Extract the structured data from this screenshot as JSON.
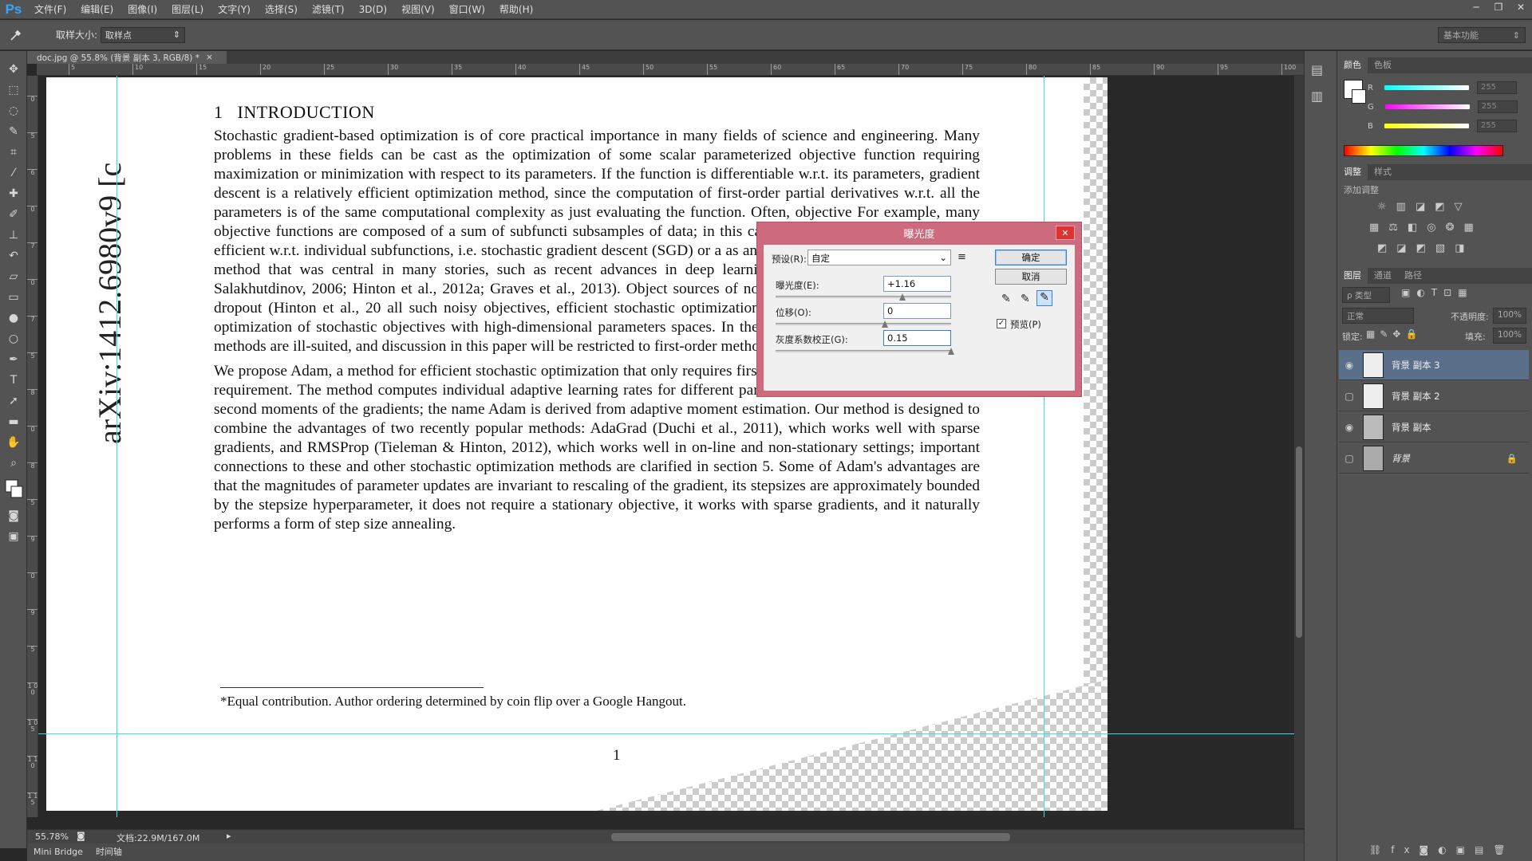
{
  "app": {
    "logo": "Ps",
    "menu": [
      "文件(F)",
      "编辑(E)",
      "图像(I)",
      "图层(L)",
      "文字(Y)",
      "选择(S)",
      "滤镜(T)",
      "3D(D)",
      "视图(V)",
      "窗口(W)",
      "帮助(H)"
    ],
    "window_controls": [
      "─",
      "❐",
      "✕"
    ]
  },
  "options_bar": {
    "sample_size_label": "取样大小:",
    "sample_size_value": "取样点",
    "workspace": "基本功能"
  },
  "document": {
    "tab_title": "doc.jpg @ 55.8% (背景 副本 3, RGB/8) *",
    "tab_close": "×",
    "ruler_top": [
      "5",
      "10",
      "15",
      "20",
      "25",
      "30",
      "35",
      "40",
      "45",
      "50",
      "55",
      "60",
      "65",
      "70",
      "75",
      "80",
      "85",
      "90",
      "95",
      "100"
    ],
    "ruler_left": [
      "0",
      "5",
      "6",
      "0",
      "7",
      "0",
      "7",
      "5",
      "8",
      "0",
      "8",
      "5",
      "9",
      "0",
      "9",
      "5",
      "1 0 0",
      "1 0 5",
      "1 1 0",
      "1 1 5"
    ]
  },
  "paper": {
    "arxiv_id": "arXiv:1412.6980v9  [c",
    "section_number": "1",
    "section_title": "INTRODUCTION",
    "paragraph1": "Stochastic gradient-based optimization is of core practical importance in many fields of science and engineering. Many problems in these fields can be cast as the optimization of some scalar parameterized objective function requiring maximization or minimization with respect to its parameters. If the function is differentiable w.r.t. its parameters, gradient descent is a relatively efficient optimization method, since the computation of first-order partial derivatives w.r.t. all the parameters is of the same computational complexity as just evaluating the function. Often, objective For example, many objective functions are composed of a sum of subfuncti subsamples of data; in this case optimization can be made more efficient w.r.t. individual subfunctions, i.e. stochastic gradient descent (SGD) or a as an efficient and effective optimization method that was central in many stories, such as recent advances in deep learning (Deng et al., 2013; Krizhe & Salakhutdinov, 2006; Hinton et al., 2012a; Graves et al., 2013). Object sources of noise than data subsampling, such as dropout (Hinton et al., 20 all such noisy objectives, efficient stochastic optimization techniques are re paper is on the optimization of stochastic objectives with high-dimensional parameters spaces. In these cases, higher-order optimization methods are ill-suited, and discussion in this paper will be restricted to first-order methods.",
    "paragraph2": "We propose Adam, a method for efficient stochastic optimization that only requires first-order gradients with little memory requirement. The method computes individual adaptive learning rates for different parameters from estimates of first and second moments of the gradients; the name Adam is derived from adaptive moment estimation. Our method is designed to combine the advantages of two recently popular methods: AdaGrad (Duchi et al., 2011), which works well with sparse gradients, and RMSProp (Tieleman & Hinton, 2012), which works well in on-line and non-stationary settings; important connections to these and other stochastic optimization methods are clarified in section 5. Some of Adam's advantages are that the magnitudes of parameter updates are invariant to rescaling of the gradient, its stepsizes are approximately bounded by the stepsize hyperparameter, it does not require a stationary objective, it works with sparse gradients, and it naturally performs a form of step size annealing.",
    "footnote": "*Equal contribution. Author ordering determined by coin flip over a Google Hangout.",
    "page_number": "1"
  },
  "status": {
    "zoom": "55.78%",
    "doc_size": "文档:22.9M/167.0M"
  },
  "bottom_tabs": [
    "Mini Bridge",
    "时间轴"
  ],
  "dialog": {
    "title": "曝光度",
    "close": "✕",
    "preset_label": "预设(R):",
    "preset_value": "自定",
    "exposure_label": "曝光度(E):",
    "exposure_value": "+1.16",
    "offset_label": "位移(O):",
    "offset_value": "0",
    "gamma_label": "灰度系数校正(G):",
    "gamma_value": "0.15",
    "ok": "确定",
    "cancel": "取消",
    "preview_label": "预览(P)",
    "preview_checked": true
  },
  "color_panel": {
    "tabs": [
      "颜色",
      "色板"
    ],
    "channels": [
      {
        "name": "R",
        "value": "255",
        "color": "#00e5e5"
      },
      {
        "name": "G",
        "value": "255",
        "color": "#e500e5"
      },
      {
        "name": "B",
        "value": "255",
        "color": "#e5e500"
      }
    ]
  },
  "adjust_panel": {
    "tabs": [
      "调整",
      "样式"
    ],
    "add_label": "添加调整"
  },
  "layers_panel": {
    "tabs": [
      "图层",
      "通道",
      "路径"
    ],
    "filter": "ρ 类型",
    "blend_mode": "正常",
    "opacity_label": "不透明度:",
    "opacity_value": "100%",
    "lock_label": "锁定:",
    "fill_label": "填充:",
    "fill_value": "100%",
    "layers": [
      {
        "name": "背景 副本 3",
        "visible": true,
        "selected": true
      },
      {
        "name": "背景 副本 2",
        "visible": false,
        "selected": false
      },
      {
        "name": "背景 副本",
        "visible": true,
        "selected": false
      },
      {
        "name": "背景",
        "visible": false,
        "selected": false,
        "locked": true
      }
    ]
  }
}
